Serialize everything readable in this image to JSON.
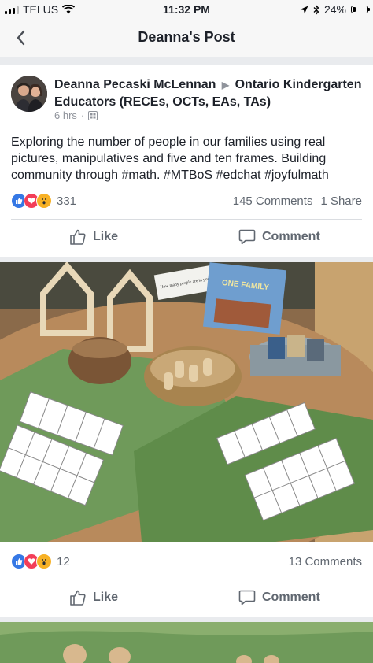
{
  "status_bar": {
    "carrier": "TELUS",
    "time": "11:32 PM",
    "battery": "24%",
    "battery_level": 0.24
  },
  "nav": {
    "title": "Deanna's Post"
  },
  "post": {
    "author": "Deanna Pecaski McLennan",
    "group": "Ontario Kindergarten Educators (RECEs, OCTs, EAs, TAs)",
    "time": "6 hrs",
    "text": "Exploring the number of people in our families using real pictures, manipulatives and five and ten frames. Building community through #math. #MTBoS #edchat #joyfulmath",
    "reactions_count": "331",
    "comments": "145 Comments",
    "shares": "1 Share",
    "like_label": "Like",
    "comment_label": "Comment"
  },
  "photo_post": {
    "card_text": "How many people are in your family?",
    "book_title": "ONE FAMILY",
    "reactions_count": "12",
    "comments": "13 Comments",
    "like_label": "Like",
    "comment_label": "Comment"
  },
  "colors": {
    "facebook_blue": "#3578e5",
    "love_red": "#f33e58",
    "wow_yellow": "#f7b125",
    "text_primary": "#1d2129",
    "text_secondary": "#606770",
    "background": "#e9ebee"
  },
  "icons": [
    "wifi-icon",
    "location-arrow-icon",
    "bluetooth-icon",
    "battery-icon",
    "back-chevron-icon",
    "globe-privacy-icon",
    "like-reaction-icon",
    "love-reaction-icon",
    "wow-reaction-icon",
    "thumbs-up-icon",
    "comment-bubble-icon"
  ]
}
